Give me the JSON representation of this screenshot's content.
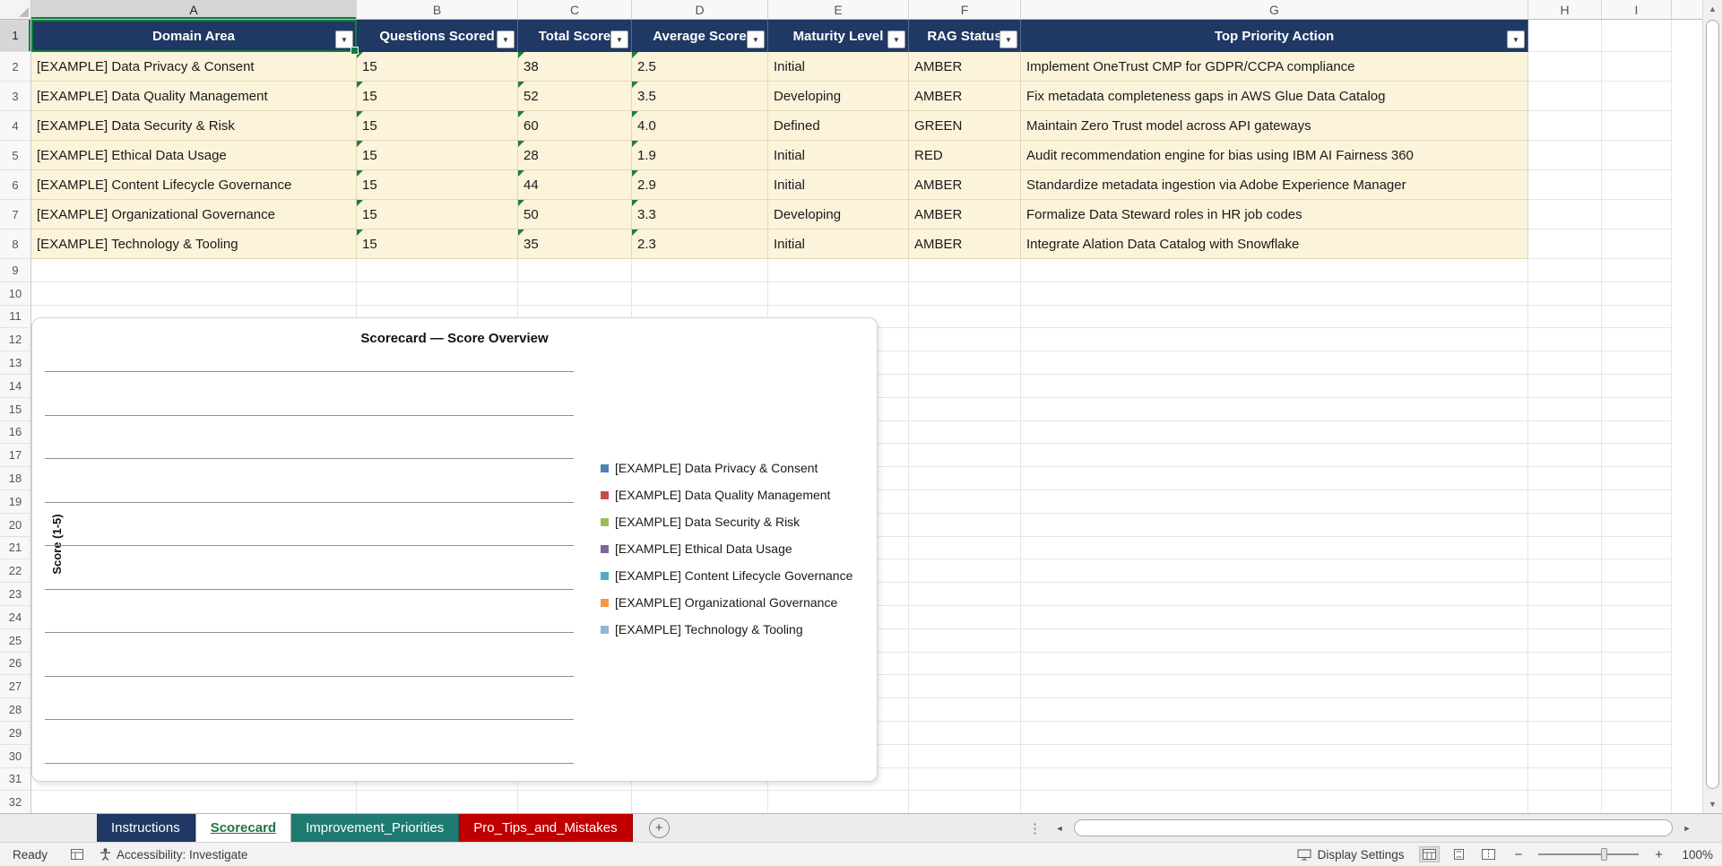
{
  "spreadsheet": {
    "column_letters": [
      "A",
      "B",
      "C",
      "D",
      "E",
      "F",
      "G",
      "H",
      "I"
    ],
    "first_row": 1,
    "last_row": 32,
    "selected_cell": "A1"
  },
  "table": {
    "headers": [
      "Domain Area",
      "Questions Scored",
      "Total Score",
      "Average Score",
      "Maturity Level",
      "RAG Status",
      "Top Priority Action"
    ],
    "rows": [
      [
        "[EXAMPLE] Data Privacy & Consent",
        "15",
        "38",
        "2.5",
        "Initial",
        "AMBER",
        "Implement OneTrust CMP for GDPR/CCPA compliance"
      ],
      [
        "[EXAMPLE] Data Quality Management",
        "15",
        "52",
        "3.5",
        "Developing",
        "AMBER",
        "Fix metadata completeness gaps in AWS Glue Data Catalog"
      ],
      [
        "[EXAMPLE] Data Security & Risk",
        "15",
        "60",
        "4.0",
        "Defined",
        "GREEN",
        "Maintain Zero Trust model across API gateways"
      ],
      [
        "[EXAMPLE] Ethical Data Usage",
        "15",
        "28",
        "1.9",
        "Initial",
        "RED",
        "Audit recommendation engine for bias using IBM AI Fairness 360"
      ],
      [
        "[EXAMPLE] Content Lifecycle Governance",
        "15",
        "44",
        "2.9",
        "Initial",
        "AMBER",
        "Standardize metadata ingestion via Adobe Experience Manager"
      ],
      [
        "[EXAMPLE] Organizational Governance",
        "15",
        "50",
        "3.3",
        "Developing",
        "AMBER",
        "Formalize Data Steward roles in HR job codes"
      ],
      [
        "[EXAMPLE] Technology & Tooling",
        "15",
        "35",
        "2.3",
        "Initial",
        "AMBER",
        "Integrate Alation Data Catalog with Snowflake"
      ]
    ],
    "header_bg": "#1F3864",
    "row_bg": "#FCF3DB",
    "selection_color": "#107C41"
  },
  "chart_data": {
    "type": "bar",
    "title": "Scorecard — Score Overview",
    "ylabel": "Score (1-5)",
    "series": [],
    "gridline_count": 10,
    "grid": true,
    "legend_position": "right",
    "legend": [
      {
        "label": "[EXAMPLE] Data Privacy & Consent",
        "color": "#4F81BD"
      },
      {
        "label": "[EXAMPLE] Data Quality Management",
        "color": "#C0504D"
      },
      {
        "label": "[EXAMPLE] Data Security & Risk",
        "color": "#9BBB59"
      },
      {
        "label": "[EXAMPLE] Ethical Data Usage",
        "color": "#8064A2"
      },
      {
        "label": "[EXAMPLE] Content Lifecycle Governance",
        "color": "#4BACC6"
      },
      {
        "label": "[EXAMPLE] Organizational Governance",
        "color": "#F79646"
      },
      {
        "label": "[EXAMPLE] Technology & Tooling",
        "color": "#95B3D7"
      }
    ]
  },
  "sheet_tabs": {
    "tabs": [
      {
        "label": "Instructions",
        "bg": "#1F3864",
        "fg": "#FFFFFF",
        "active": false
      },
      {
        "label": "Scorecard",
        "bg": "#FFFFFF",
        "fg": "#217346",
        "active": true
      },
      {
        "label": "Improvement_Priorities",
        "bg": "#1F7A72",
        "fg": "#FFFFFF",
        "active": false
      },
      {
        "label": "Pro_Tips_and_Mistakes",
        "bg": "#C00000",
        "fg": "#FFFFFF",
        "active": false
      }
    ]
  },
  "status_bar": {
    "ready_label": "Ready",
    "accessibility_label": "Accessibility: Investigate",
    "display_settings_label": "Display Settings",
    "zoom_label": "100%"
  },
  "icons": {
    "filter_arrow": "▼",
    "scroll_up": "▲",
    "scroll_down": "▼",
    "scroll_left": "◄",
    "scroll_right": "►",
    "splitter": "⋮",
    "add_sheet": "+",
    "zoom_out": "−",
    "zoom_in": "+"
  }
}
